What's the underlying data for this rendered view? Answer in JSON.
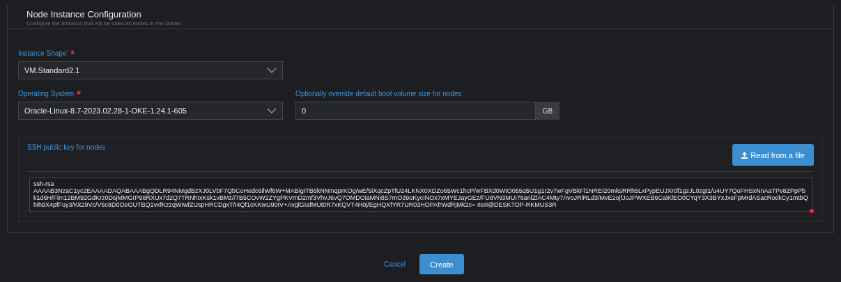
{
  "section": {
    "title": "Node Instance Configuration",
    "subtitle": "Configure the instance that will be used as nodes in the cluster."
  },
  "shape": {
    "label": "Instance Shape'",
    "required": true,
    "value": "VM.Standard2.1"
  },
  "os": {
    "label": "Operating System",
    "required": true,
    "value": "Oracle-Linux-8.7-2023.02.28-1-OKE-1.24.1-605"
  },
  "boot_volume": {
    "label": "Optionally override default boot volume size for nodes",
    "value": "0",
    "unit": "GB"
  },
  "ssh": {
    "label": "SSH public key for nodes",
    "button": "Read from a file",
    "value": "ssh-rsa AAAAB3NzaC1yc2EAAAADAQABAAABgQDLR94NMgdBzXJ0LVbF7QbCoHedc6ilWf6W+MABigITB6kNNmqprKOg/wE/5iXqcZpTlU24LKNX0XDZo65Wc1hcP/wFBXd0WtO055q5U1g1r2v7wFgVBkFl1NREI20mksRRh5LxPypEUJXr0f1gzJL0zgt1/u4UY7QoFHSxNnAaTPv8ZPpPbk1d6H/Fim12BM92GdKrz0DsjMMGrP98RXUx7d2Q7TRNhIxKsk1vBMz//7B5COvW2ZYgPKVmD2mf3VhvJ6vQ7OMDOiaMNi8S7mO39oKycINOx7xMYEJayGEz/FU8VN3MUI76anlZlAC4Mty7AvoJRlRLd3/MvE2ojfJoJPWXEB6CaiKlEO0CYqY3X3BYxJxeFpMrdASacRoekCy1mtbQhih9X4pfFuy3/Kk29Vc/V6c8D0OeGUTBQ1vxfKzzqWIwfZUspHRCDgxT/I4Qf1cKKwU90IV+AvglGIafMUt0R7xKQVT4H0j/EgHQXfYR7UR03HOPAfrWdRjMk2c= rieri@DESKTOP-RKMUS3R"
  },
  "actions": {
    "cancel": "Cancel",
    "create": "Create"
  }
}
